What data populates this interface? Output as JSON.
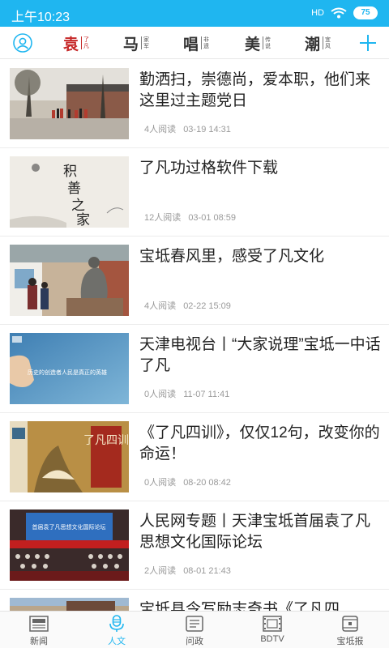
{
  "status_bar": {
    "time": "上午10:23",
    "signal": "HD",
    "battery": "75"
  },
  "nav": {
    "channels": [
      {
        "main": "袁",
        "sub": [
          "了",
          "凡"
        ],
        "active": true
      },
      {
        "main": "马",
        "sub": [
          "家",
          "军"
        ],
        "active": false
      },
      {
        "main": "唱",
        "sub": [
          "非",
          "遗"
        ],
        "active": false
      },
      {
        "main": "美",
        "sub": [
          "传",
          "说"
        ],
        "active": false
      },
      {
        "main": "潮",
        "sub": [
          "宜",
          "风"
        ],
        "active": false
      }
    ]
  },
  "articles": [
    {
      "title": "勤洒扫，崇德尚，爱本职，他们来这里过主题党日",
      "reads": "4人阅读",
      "date": "03-19 14:31"
    },
    {
      "title": "了凡功过格软件下载",
      "reads": "12人阅读",
      "date": "03-01 08:59"
    },
    {
      "title": "宝坻春风里，感受了凡文化",
      "reads": "4人阅读",
      "date": "02-22 15:09"
    },
    {
      "title": "天津电视台丨“大家说理”宝坻一中话了凡",
      "reads": "0人阅读",
      "date": "11-07 11:41"
    },
    {
      "title": "《了凡四训》，仅仅12句，改变你的命运！",
      "reads": "0人阅读",
      "date": "08-20 08:42"
    },
    {
      "title": "人民网专题丨天津宝坻首届袁了凡思想文化国际论坛",
      "reads": "2人阅读",
      "date": "08-01 21:43"
    },
    {
      "title": "宝坻县令写励志奇书《了凡四",
      "reads": "",
      "date": ""
    }
  ],
  "thumb_text": {
    "calligraphy": [
      "积",
      "善",
      "之",
      "家"
    ],
    "tv_caption": "历史的创造者人民是真正的英雄",
    "book_title": "了凡四训",
    "forum_banner": "首届袁了凡思想文化国际论坛"
  },
  "tabs": [
    {
      "label": "新闻",
      "icon": "newspaper-icon",
      "active": false
    },
    {
      "label": "人文",
      "icon": "microphone-icon",
      "active": true
    },
    {
      "label": "问政",
      "icon": "document-icon",
      "active": false
    },
    {
      "label": "BDTV",
      "icon": "film-icon",
      "active": false
    },
    {
      "label": "宝坻报",
      "icon": "scroll-icon",
      "active": false
    }
  ],
  "colors": {
    "accent": "#1fb6f0",
    "active_channel": "#c62828"
  }
}
